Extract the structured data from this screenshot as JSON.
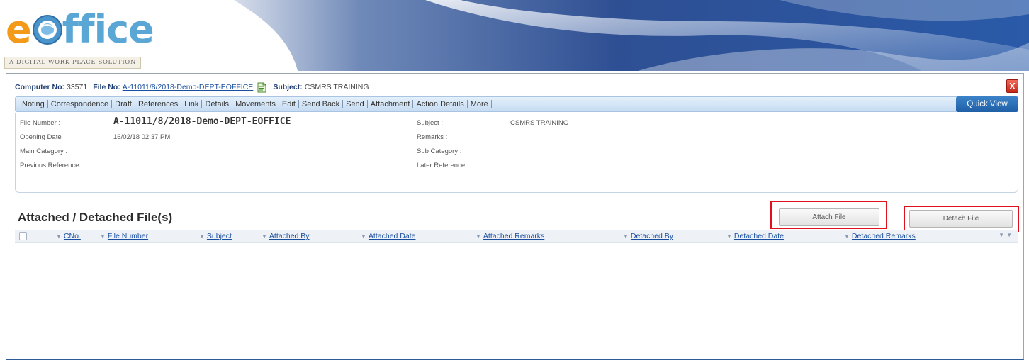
{
  "logo": {
    "text_rest": "ffice",
    "tagline": "A DIGITAL WORK PLACE SOLUTION"
  },
  "info_bar": {
    "computer_no_label": "Computer No:",
    "computer_no": "33571",
    "file_no_label": "File No:",
    "file_no": "A-11011/8/2018-Demo-DEPT-EOFFICE",
    "subject_label": "Subject:",
    "subject": "CSMRS TRAINING"
  },
  "close_label": "X",
  "nav": {
    "items": [
      "Noting",
      "Correspondence",
      "Draft",
      "References",
      "Link",
      "Details",
      "Movements",
      "Edit",
      "Send Back",
      "Send",
      "Attachment",
      "Action Details",
      "More"
    ],
    "quick_view": "Quick View"
  },
  "details": {
    "file_number_label": "File Number :",
    "file_number": "A-11011/8/2018-Demo-DEPT-EOFFICE",
    "opening_date_label": "Opening Date :",
    "opening_date": "16/02/18 02:37 PM",
    "main_category_label": "Main Category :",
    "previous_reference_label": "Previous Reference :",
    "subject_label": "Subject :",
    "subject": "CSMRS TRAINING",
    "remarks_label": "Remarks :",
    "sub_category_label": "Sub Category :",
    "later_reference_label": "Later Reference :"
  },
  "section": {
    "title": "Attached / Detached File(s)",
    "attach_button": "Attach File",
    "detach_button": "Detach File"
  },
  "grid": {
    "columns": [
      "CNo.",
      "File Number",
      "Subject",
      "Attached By",
      "Attached Date",
      "Attached Remarks",
      "Detached By",
      "Detached Date",
      "Detached Remarks"
    ]
  },
  "colors": {
    "logo_orange": "#f39a18",
    "logo_blue": "#5aa7d6",
    "quick_view_blue": "#2a6eb8",
    "highlight_red": "#e0101c"
  }
}
